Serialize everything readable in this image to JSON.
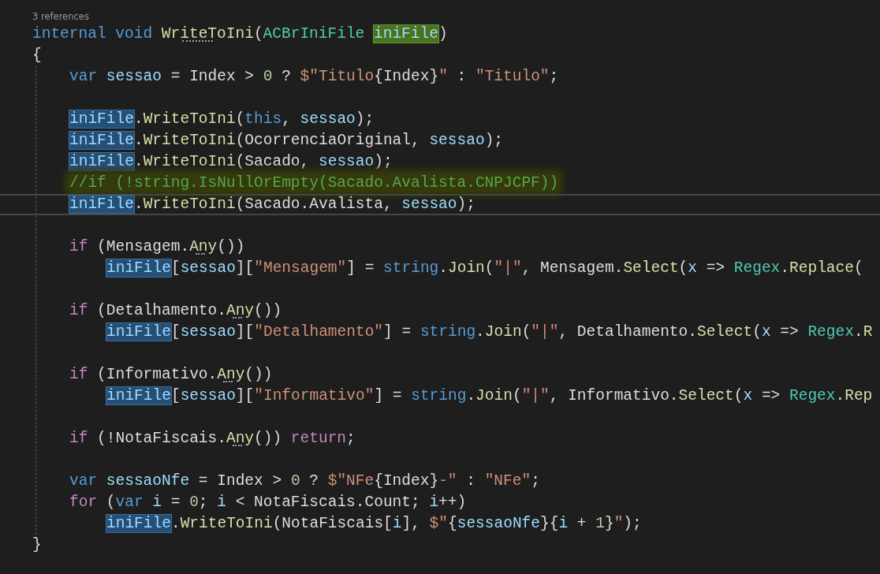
{
  "codelens": "3 references",
  "lines": [
    {
      "kind": "top",
      "tokens": [
        {
          "text": "internal ",
          "kind": "keyword"
        },
        {
          "text": "void ",
          "kind": "keyword"
        },
        {
          "text": "WriteToIni",
          "kind": "method",
          "hint": true
        },
        {
          "text": "(",
          "kind": "plain"
        },
        {
          "text": "ACBrIniFile ",
          "kind": "type"
        },
        {
          "text": "iniFile",
          "kind": "parameter",
          "highlighted": true
        },
        {
          "text": ")",
          "kind": "plain"
        }
      ]
    },
    {
      "kind": "top",
      "tokens": [
        {
          "text": "{",
          "kind": "plain"
        }
      ]
    },
    {
      "kind": "body",
      "tokens": [
        {
          "text": "var ",
          "kind": "keyword"
        },
        {
          "text": "sessao",
          "kind": "variable"
        },
        {
          "text": " = Index > ",
          "kind": "plain"
        },
        {
          "text": "0",
          "kind": "number"
        },
        {
          "text": " ? ",
          "kind": "plain"
        },
        {
          "text": "$\"Titulo",
          "kind": "string"
        },
        {
          "text": "{Index}",
          "kind": "plain"
        },
        {
          "text": "\"",
          "kind": "string"
        },
        {
          "text": " : ",
          "kind": "plain"
        },
        {
          "text": "\"Titulo\"",
          "kind": "string"
        },
        {
          "text": ";",
          "kind": "plain"
        }
      ]
    },
    {
      "kind": "blank"
    },
    {
      "kind": "body",
      "tokens": [
        {
          "text": "iniFile",
          "kind": "variable",
          "highlighted": true
        },
        {
          "text": ".",
          "kind": "plain"
        },
        {
          "text": "WriteToIni",
          "kind": "method"
        },
        {
          "text": "(",
          "kind": "plain"
        },
        {
          "text": "this",
          "kind": "keyword"
        },
        {
          "text": ", ",
          "kind": "plain"
        },
        {
          "text": "sessao",
          "kind": "variable"
        },
        {
          "text": ");",
          "kind": "plain"
        }
      ]
    },
    {
      "kind": "body",
      "tokens": [
        {
          "text": "iniFile",
          "kind": "variable",
          "highlighted": true
        },
        {
          "text": ".",
          "kind": "plain"
        },
        {
          "text": "WriteToIni",
          "kind": "method"
        },
        {
          "text": "(OcorrenciaOriginal, ",
          "kind": "plain"
        },
        {
          "text": "sessao",
          "kind": "variable"
        },
        {
          "text": ");",
          "kind": "plain"
        }
      ]
    },
    {
      "kind": "body",
      "tokens": [
        {
          "text": "iniFile",
          "kind": "variable",
          "highlighted": true
        },
        {
          "text": ".",
          "kind": "plain"
        },
        {
          "text": "WriteToIni",
          "kind": "method"
        },
        {
          "text": "(Sacado, ",
          "kind": "plain"
        },
        {
          "text": "sessao",
          "kind": "variable"
        },
        {
          "text": ");",
          "kind": "plain"
        }
      ]
    },
    {
      "kind": "body",
      "band": true,
      "tokens": [
        {
          "text": "//if (!string.IsNullOrEmpty(Sacado.Avalista.CNPJCPF))",
          "kind": "comment"
        }
      ]
    },
    {
      "kind": "body",
      "current": true,
      "tokens": [
        {
          "text": "iniFile",
          "kind": "variable",
          "highlighted": true
        },
        {
          "text": ".",
          "kind": "plain"
        },
        {
          "text": "WriteToIni",
          "kind": "method"
        },
        {
          "text": "(Sacado.Avalista, ",
          "kind": "plain"
        },
        {
          "text": "sessao",
          "kind": "variable"
        },
        {
          "text": ");",
          "kind": "plain"
        }
      ]
    },
    {
      "kind": "blank"
    },
    {
      "kind": "body",
      "tokens": [
        {
          "text": "if",
          "kind": "control"
        },
        {
          "text": " (Mensagem.",
          "kind": "plain"
        },
        {
          "text": "Any",
          "kind": "method",
          "hint": true
        },
        {
          "text": "())",
          "kind": "plain"
        }
      ]
    },
    {
      "kind": "nested",
      "tokens": [
        {
          "text": "iniFile",
          "kind": "variable",
          "highlighted": true
        },
        {
          "text": "[",
          "kind": "plain"
        },
        {
          "text": "sessao",
          "kind": "variable"
        },
        {
          "text": "][",
          "kind": "plain"
        },
        {
          "text": "\"Mensagem\"",
          "kind": "string"
        },
        {
          "text": "] = ",
          "kind": "plain"
        },
        {
          "text": "string",
          "kind": "keyword"
        },
        {
          "text": ".",
          "kind": "plain"
        },
        {
          "text": "Join",
          "kind": "method"
        },
        {
          "text": "(",
          "kind": "plain"
        },
        {
          "text": "\"|\"",
          "kind": "string"
        },
        {
          "text": ", Mensagem.",
          "kind": "plain"
        },
        {
          "text": "Select",
          "kind": "method"
        },
        {
          "text": "(",
          "kind": "plain"
        },
        {
          "text": "x",
          "kind": "variable"
        },
        {
          "text": " => ",
          "kind": "plain"
        },
        {
          "text": "Regex",
          "kind": "type"
        },
        {
          "text": ".",
          "kind": "plain"
        },
        {
          "text": "Replace",
          "kind": "method"
        },
        {
          "text": "(",
          "kind": "plain"
        }
      ]
    },
    {
      "kind": "blank"
    },
    {
      "kind": "body",
      "tokens": [
        {
          "text": "if",
          "kind": "control"
        },
        {
          "text": " (Detalhamento.",
          "kind": "plain"
        },
        {
          "text": "Any",
          "kind": "method",
          "hint": true
        },
        {
          "text": "())",
          "kind": "plain"
        }
      ]
    },
    {
      "kind": "nested",
      "tokens": [
        {
          "text": "iniFile",
          "kind": "variable",
          "highlighted": true
        },
        {
          "text": "[",
          "kind": "plain"
        },
        {
          "text": "sessao",
          "kind": "variable"
        },
        {
          "text": "][",
          "kind": "plain"
        },
        {
          "text": "\"Detalhamento\"",
          "kind": "string"
        },
        {
          "text": "] = ",
          "kind": "plain"
        },
        {
          "text": "string",
          "kind": "keyword"
        },
        {
          "text": ".",
          "kind": "plain"
        },
        {
          "text": "Join",
          "kind": "method"
        },
        {
          "text": "(",
          "kind": "plain"
        },
        {
          "text": "\"|\"",
          "kind": "string"
        },
        {
          "text": ", Detalhamento.",
          "kind": "plain"
        },
        {
          "text": "Select",
          "kind": "method"
        },
        {
          "text": "(",
          "kind": "plain"
        },
        {
          "text": "x",
          "kind": "variable"
        },
        {
          "text": " => ",
          "kind": "plain"
        },
        {
          "text": "Regex",
          "kind": "type"
        },
        {
          "text": ".",
          "kind": "plain"
        },
        {
          "text": "R",
          "kind": "method"
        }
      ]
    },
    {
      "kind": "blank"
    },
    {
      "kind": "body",
      "tokens": [
        {
          "text": "if",
          "kind": "control"
        },
        {
          "text": " (Informativo.",
          "kind": "plain"
        },
        {
          "text": "Any",
          "kind": "method",
          "hint": true
        },
        {
          "text": "())",
          "kind": "plain"
        }
      ]
    },
    {
      "kind": "nested",
      "tokens": [
        {
          "text": "iniFile",
          "kind": "variable",
          "highlighted": true
        },
        {
          "text": "[",
          "kind": "plain"
        },
        {
          "text": "sessao",
          "kind": "variable"
        },
        {
          "text": "][",
          "kind": "plain"
        },
        {
          "text": "\"Informativo\"",
          "kind": "string"
        },
        {
          "text": "] = ",
          "kind": "plain"
        },
        {
          "text": "string",
          "kind": "keyword"
        },
        {
          "text": ".",
          "kind": "plain"
        },
        {
          "text": "Join",
          "kind": "method"
        },
        {
          "text": "(",
          "kind": "plain"
        },
        {
          "text": "\"|\"",
          "kind": "string"
        },
        {
          "text": ", Informativo.",
          "kind": "plain"
        },
        {
          "text": "Select",
          "kind": "method"
        },
        {
          "text": "(",
          "kind": "plain"
        },
        {
          "text": "x",
          "kind": "variable"
        },
        {
          "text": " => ",
          "kind": "plain"
        },
        {
          "text": "Regex",
          "kind": "type"
        },
        {
          "text": ".",
          "kind": "plain"
        },
        {
          "text": "Rep",
          "kind": "method"
        }
      ]
    },
    {
      "kind": "blank"
    },
    {
      "kind": "body",
      "tokens": [
        {
          "text": "if",
          "kind": "control"
        },
        {
          "text": " (!NotaFiscais.",
          "kind": "plain"
        },
        {
          "text": "Any",
          "kind": "method",
          "hint": true
        },
        {
          "text": "()) ",
          "kind": "plain"
        },
        {
          "text": "return",
          "kind": "control"
        },
        {
          "text": ";",
          "kind": "plain"
        }
      ]
    },
    {
      "kind": "blank"
    },
    {
      "kind": "body",
      "tokens": [
        {
          "text": "var ",
          "kind": "keyword"
        },
        {
          "text": "sessaoNfe",
          "kind": "variable"
        },
        {
          "text": " = Index > ",
          "kind": "plain"
        },
        {
          "text": "0",
          "kind": "number"
        },
        {
          "text": " ? ",
          "kind": "plain"
        },
        {
          "text": "$\"NFe",
          "kind": "string"
        },
        {
          "text": "{Index}",
          "kind": "plain"
        },
        {
          "text": "-\"",
          "kind": "string"
        },
        {
          "text": " : ",
          "kind": "plain"
        },
        {
          "text": "\"NFe\"",
          "kind": "string"
        },
        {
          "text": ";",
          "kind": "plain"
        }
      ]
    },
    {
      "kind": "body",
      "tokens": [
        {
          "text": "for",
          "kind": "control"
        },
        {
          "text": " (",
          "kind": "plain"
        },
        {
          "text": "var ",
          "kind": "keyword"
        },
        {
          "text": "i",
          "kind": "variable"
        },
        {
          "text": " = ",
          "kind": "plain"
        },
        {
          "text": "0",
          "kind": "number"
        },
        {
          "text": "; ",
          "kind": "plain"
        },
        {
          "text": "i",
          "kind": "variable"
        },
        {
          "text": " < NotaFiscais.Count; ",
          "kind": "plain"
        },
        {
          "text": "i",
          "kind": "variable"
        },
        {
          "text": "++)",
          "kind": "plain"
        }
      ]
    },
    {
      "kind": "nested",
      "tokens": [
        {
          "text": "iniFile",
          "kind": "variable",
          "highlighted": true
        },
        {
          "text": ".",
          "kind": "plain"
        },
        {
          "text": "WriteToIni",
          "kind": "method"
        },
        {
          "text": "(NotaFiscais[",
          "kind": "plain"
        },
        {
          "text": "i",
          "kind": "variable"
        },
        {
          "text": "], ",
          "kind": "plain"
        },
        {
          "text": "$\"",
          "kind": "string"
        },
        {
          "text": "{",
          "kind": "plain"
        },
        {
          "text": "sessaoNfe",
          "kind": "variable"
        },
        {
          "text": "}{",
          "kind": "plain"
        },
        {
          "text": "i",
          "kind": "variable"
        },
        {
          "text": " + ",
          "kind": "plain"
        },
        {
          "text": "1",
          "kind": "number"
        },
        {
          "text": "}",
          "kind": "plain"
        },
        {
          "text": "\"",
          "kind": "string"
        },
        {
          "text": ");",
          "kind": "plain"
        }
      ]
    },
    {
      "kind": "top",
      "tokens": [
        {
          "text": "}",
          "kind": "plain"
        }
      ]
    }
  ]
}
